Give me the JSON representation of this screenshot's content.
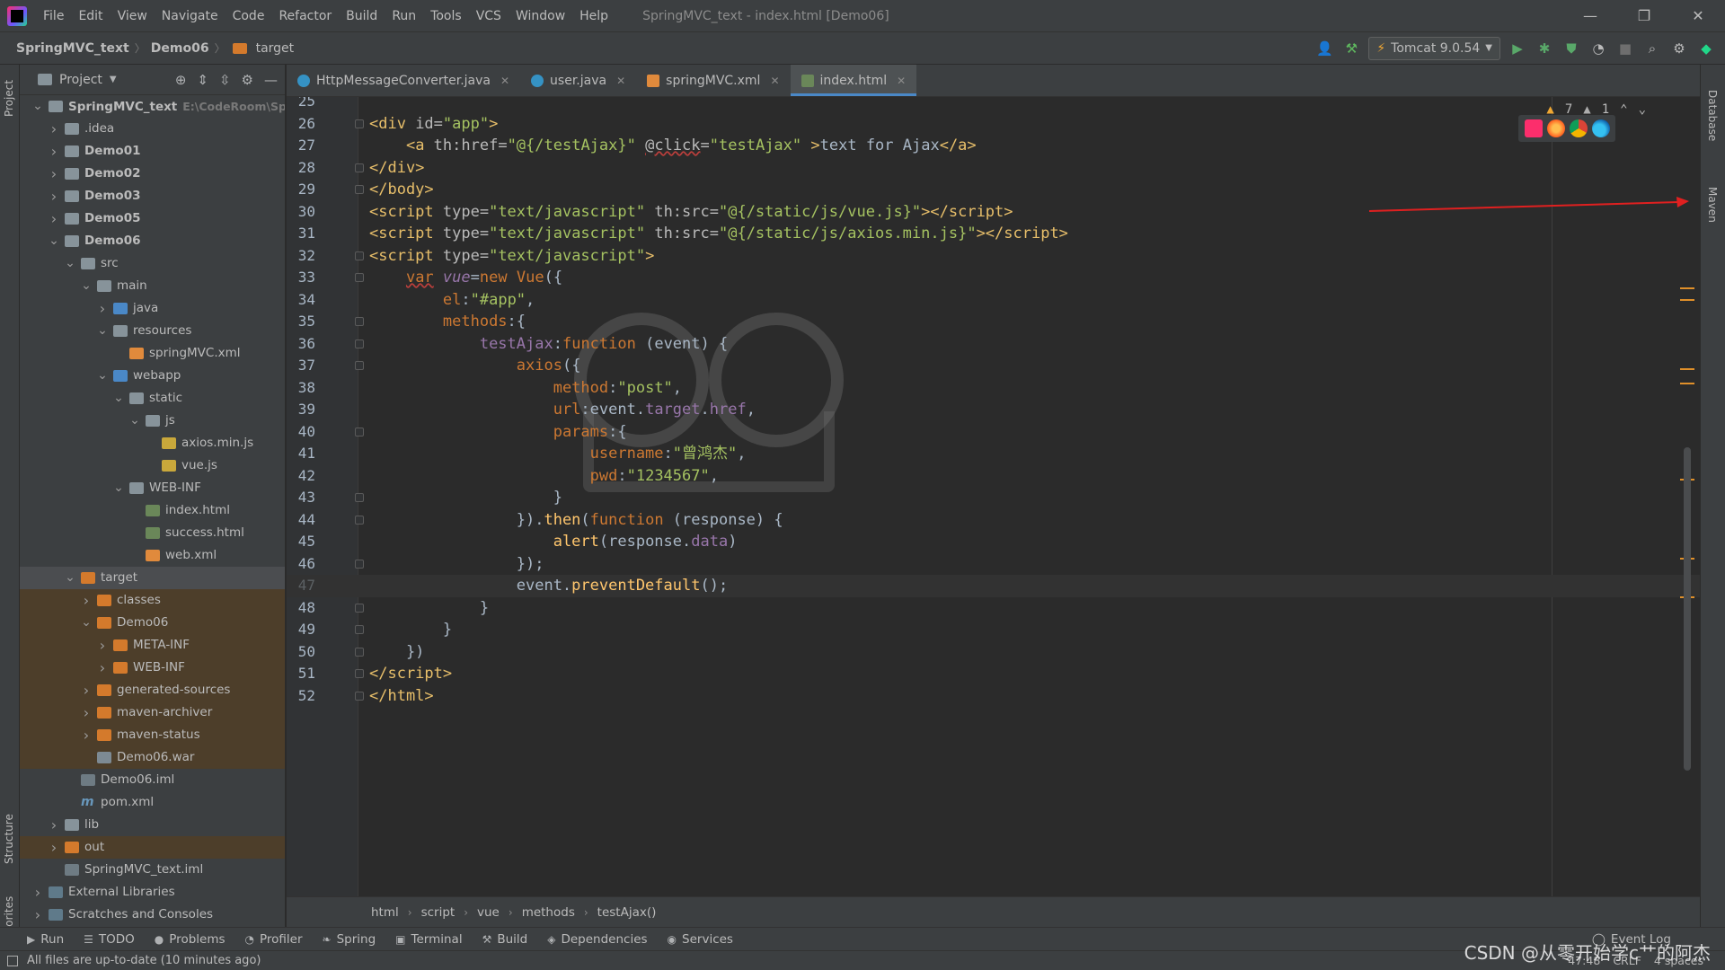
{
  "window": {
    "title": "SpringMVC_text - index.html [Demo06]",
    "menu": [
      "File",
      "Edit",
      "View",
      "Navigate",
      "Code",
      "Refactor",
      "Build",
      "Run",
      "Tools",
      "VCS",
      "Window",
      "Help"
    ],
    "controls": [
      "—",
      "❐",
      "✕"
    ]
  },
  "navbar": {
    "crumbs": [
      "SpringMVC_text",
      "Demo06",
      "target"
    ],
    "run_config": "Tomcat 9.0.54"
  },
  "stripes": {
    "left": [
      "Project",
      "Structure",
      "Favorites"
    ],
    "right": [
      "Database",
      "Maven"
    ]
  },
  "project_panel": {
    "title": "Project",
    "tree": [
      {
        "label": "SpringMVC_text",
        "path": "E:\\CodeRoom\\Spring",
        "depth": 0,
        "open": true,
        "icon": "folder",
        "bold": true
      },
      {
        "label": ".idea",
        "depth": 1,
        "open": false,
        "icon": "folder"
      },
      {
        "label": "Demo01",
        "depth": 1,
        "open": false,
        "icon": "folder",
        "bold": true
      },
      {
        "label": "Demo02",
        "depth": 1,
        "open": false,
        "icon": "folder",
        "bold": true
      },
      {
        "label": "Demo03",
        "depth": 1,
        "open": false,
        "icon": "folder",
        "bold": true
      },
      {
        "label": "Demo05",
        "depth": 1,
        "open": false,
        "icon": "folder",
        "bold": true
      },
      {
        "label": "Demo06",
        "depth": 1,
        "open": true,
        "icon": "folder",
        "bold": true
      },
      {
        "label": "src",
        "depth": 2,
        "open": true,
        "icon": "folder"
      },
      {
        "label": "main",
        "depth": 3,
        "open": true,
        "icon": "folder"
      },
      {
        "label": "java",
        "depth": 4,
        "open": false,
        "icon": "folder-blue"
      },
      {
        "label": "resources",
        "depth": 4,
        "open": true,
        "icon": "folder"
      },
      {
        "label": "springMVC.xml",
        "depth": 5,
        "icon": "file-xml"
      },
      {
        "label": "webapp",
        "depth": 4,
        "open": true,
        "icon": "folder-blue"
      },
      {
        "label": "static",
        "depth": 5,
        "open": true,
        "icon": "folder"
      },
      {
        "label": "js",
        "depth": 6,
        "open": true,
        "icon": "folder"
      },
      {
        "label": "axios.min.js",
        "depth": 7,
        "icon": "file-js"
      },
      {
        "label": "vue.js",
        "depth": 7,
        "icon": "file-js"
      },
      {
        "label": "WEB-INF",
        "depth": 5,
        "open": true,
        "icon": "folder"
      },
      {
        "label": "index.html",
        "depth": 6,
        "icon": "file-html"
      },
      {
        "label": "success.html",
        "depth": 6,
        "icon": "file-html"
      },
      {
        "label": "web.xml",
        "depth": 6,
        "icon": "file-xml"
      },
      {
        "label": "target",
        "depth": 2,
        "open": true,
        "icon": "folder-orange",
        "excluded": true,
        "selected": true
      },
      {
        "label": "classes",
        "depth": 3,
        "open": false,
        "icon": "folder-orange",
        "excluded": true
      },
      {
        "label": "Demo06",
        "depth": 3,
        "open": true,
        "icon": "folder-orange",
        "excluded": true
      },
      {
        "label": "META-INF",
        "depth": 4,
        "open": false,
        "icon": "folder-orange",
        "excluded": true
      },
      {
        "label": "WEB-INF",
        "depth": 4,
        "open": false,
        "icon": "folder-orange",
        "excluded": true
      },
      {
        "label": "generated-sources",
        "depth": 3,
        "open": false,
        "icon": "folder-orange",
        "excluded": true
      },
      {
        "label": "maven-archiver",
        "depth": 3,
        "open": false,
        "icon": "folder-orange",
        "excluded": true
      },
      {
        "label": "maven-status",
        "depth": 3,
        "open": false,
        "icon": "folder-orange",
        "excluded": true
      },
      {
        "label": "Demo06.war",
        "depth": 3,
        "icon": "file-war",
        "excluded": true
      },
      {
        "label": "Demo06.iml",
        "depth": 2,
        "icon": "file-iml"
      },
      {
        "label": "pom.xml",
        "depth": 2,
        "icon": "maven"
      },
      {
        "label": "lib",
        "depth": 1,
        "open": false,
        "icon": "folder"
      },
      {
        "label": "out",
        "depth": 1,
        "open": false,
        "icon": "folder-orange",
        "excluded": true
      },
      {
        "label": "SpringMVC_text.iml",
        "depth": 1,
        "icon": "file-iml"
      },
      {
        "label": "External Libraries",
        "depth": 0,
        "open": false,
        "icon": "lib"
      },
      {
        "label": "Scratches and Consoles",
        "depth": 0,
        "open": false,
        "icon": "lib"
      }
    ]
  },
  "tabs": [
    {
      "label": "HttpMessageConverter.java",
      "icon": "class",
      "active": false
    },
    {
      "label": "user.java",
      "icon": "class",
      "active": false
    },
    {
      "label": "springMVC.xml",
      "icon": "xml",
      "active": false
    },
    {
      "label": "index.html",
      "icon": "html",
      "active": true
    }
  ],
  "inspections": {
    "warnings": "7",
    "weak_warnings": "1"
  },
  "editor": {
    "current_line": 47,
    "lines": [
      {
        "n": "25",
        "html": ""
      },
      {
        "n": "26",
        "html": "<span class=\"t\">&lt;div </span><span class=\"at\">id=</span><span class=\"av\">\"app\"</span><span class=\"t\">&gt;</span>"
      },
      {
        "n": "27",
        "html": "    <span class=\"t\">&lt;a </span><span class=\"at\">th:href=</span><span class=\"av\">\"@{/testAjax}\"</span> <span class=\"at sq\">@click</span><span class=\"at\">=</span><span class=\"av\">\"testAjax\"</span> <span class=\"t\">&gt;</span>text for Ajax<span class=\"t\">&lt;/a&gt;</span>"
      },
      {
        "n": "28",
        "html": "<span class=\"t\">&lt;/div&gt;</span>"
      },
      {
        "n": "29",
        "html": "<span class=\"t\">&lt;/body&gt;</span>"
      },
      {
        "n": "30",
        "html": "<span class=\"t\">&lt;script </span><span class=\"at\">type=</span><span class=\"av\">\"text/javascript\"</span> <span class=\"at\">th:src=</span><span class=\"av\">\"@{/static/js/vue.js}\"</span><span class=\"t\">&gt;&lt;/script&gt;</span>"
      },
      {
        "n": "31",
        "html": "<span class=\"t\">&lt;script </span><span class=\"at\">type=</span><span class=\"av\">\"text/javascript\"</span> <span class=\"at\">th:src=</span><span class=\"av\">\"@{/static/js/axios.min.js}\"</span><span class=\"t\">&gt;&lt;/script&gt;</span>"
      },
      {
        "n": "32",
        "html": "<span class=\"t\">&lt;script </span><span class=\"at\">type=</span><span class=\"av\">\"text/javascript\"</span><span class=\"t\">&gt;</span>"
      },
      {
        "n": "33",
        "html": "    <span class=\"kw sq\">var</span> <span class=\"vname\">vue</span>=<span class=\"kw\">new</span> <span class=\"kw\">Vue</span>({"
      },
      {
        "n": "34",
        "html": "        <span class=\"kw\">el</span>:<span class=\"av\">\"#app\"</span>,"
      },
      {
        "n": "35",
        "html": "        <span class=\"kw\">methods</span>:{"
      },
      {
        "n": "36",
        "html": "            <span class=\"prop\">testAjax</span>:<span class=\"kw\">function</span> (event) {"
      },
      {
        "n": "37",
        "html": "                <span class=\"kw\">axios</span>({"
      },
      {
        "n": "38",
        "html": "                    <span class=\"kw\">method</span>:<span class=\"av\">\"post\"</span>,"
      },
      {
        "n": "39",
        "html": "                    <span class=\"kw\">url</span>:event.<span class=\"prop\">target</span>.<span class=\"prop\">href</span>,"
      },
      {
        "n": "40",
        "html": "                    <span class=\"kw\">params</span>:{"
      },
      {
        "n": "41",
        "html": "                        <span class=\"kw\">username</span>:<span class=\"av\">\"曾鸿杰\"</span>,"
      },
      {
        "n": "42",
        "html": "                        <span class=\"kw\">pwd</span>:<span class=\"av\">\"1234567\"</span>,"
      },
      {
        "n": "43",
        "html": "                    }"
      },
      {
        "n": "44",
        "html": "                }).<span class=\"fn\">then</span>(<span class=\"kw\">function</span> (response) {"
      },
      {
        "n": "45",
        "html": "                    <span class=\"fn\">alert</span>(response.<span class=\"prop\">data</span>)"
      },
      {
        "n": "46",
        "html": "                });"
      },
      {
        "n": "47",
        "html": "                event.<span class=\"fn\">preventDefault</span>();"
      },
      {
        "n": "48",
        "html": "            }"
      },
      {
        "n": "49",
        "html": "        }"
      },
      {
        "n": "50",
        "html": "    })"
      },
      {
        "n": "51",
        "html": "<span class=\"t\">&lt;/script&gt;</span>"
      },
      {
        "n": "52",
        "html": "<span class=\"t\">&lt;/html&gt;</span>"
      }
    ]
  },
  "code_breadcrumb": [
    "html",
    "script",
    "vue",
    "methods",
    "testAjax()"
  ],
  "toolwindows": [
    {
      "label": "Run",
      "icon": "▶"
    },
    {
      "label": "TODO",
      "icon": "☰"
    },
    {
      "label": "Problems",
      "icon": "●"
    },
    {
      "label": "Profiler",
      "icon": "◔"
    },
    {
      "label": "Spring",
      "icon": "❧"
    },
    {
      "label": "Terminal",
      "icon": "▣"
    },
    {
      "label": "Build",
      "icon": "⚒"
    },
    {
      "label": "Dependencies",
      "icon": "◈"
    },
    {
      "label": "Services",
      "icon": "◉"
    }
  ],
  "event_log": "Event Log",
  "status": {
    "message": "All files are up-to-date (10 minutes ago)",
    "position": "47:48",
    "line_sep": "CRLF",
    "indent": "4 spaces"
  },
  "watermark": "CSDN @从零开始学c艹的阿杰"
}
